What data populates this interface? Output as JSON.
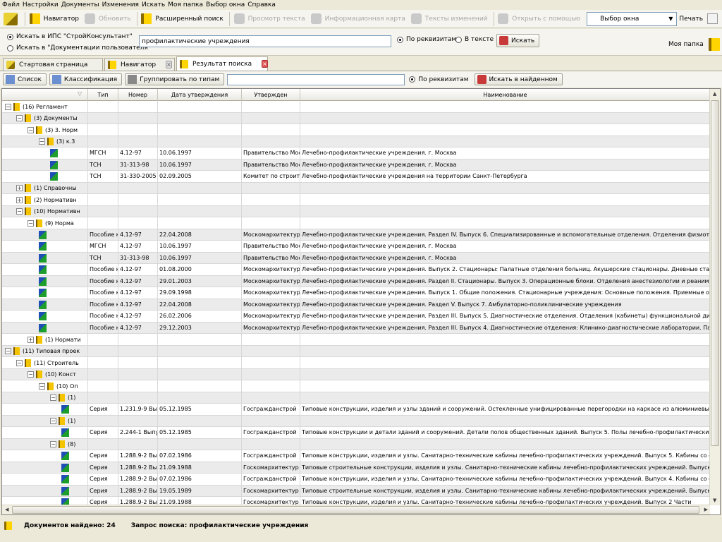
{
  "menu": [
    "Файл",
    "Настройки",
    "Документы",
    "Изменения",
    "Искать",
    "Моя папка",
    "Выбор окна",
    "Справка"
  ],
  "toolbar": {
    "navigator": "Навигатор",
    "refresh": "Обновить",
    "advanced_search": "Расширенный поиск",
    "view_text": "Просмотр текста",
    "info_card": "Информационная карта",
    "change_texts": "Тексты изменений",
    "open_with": "Открыть с помощью",
    "window_select": "Выбор окна",
    "print": "Печать"
  },
  "search": {
    "scope_ips": "Искать в ИПС \"СтройКонсультант\"",
    "scope_user": "Искать в \"Документации пользователя\"",
    "query": "профилактические учреждения",
    "mode_attrs": "По реквизитам",
    "mode_text": "В тексте",
    "search_btn": "Искать",
    "my_folder": "Моя папка"
  },
  "tabs": [
    "Стартовая страница",
    "Навигатор",
    "Результат поиска"
  ],
  "results_toolbar": {
    "list": "Список",
    "classification": "Классификация",
    "group_by_type": "Группировать по типам",
    "by_attrs": "По реквизитам",
    "search_in_found": "Искать в найденном"
  },
  "grid": {
    "headers": [
      "Тип",
      "Номер",
      "Дата утверждения",
      "Утвержден",
      "Наименование"
    ],
    "rows": [
      {
        "level": 0,
        "exp": "−",
        "kind": "folder",
        "label": "(16)  Регламент"
      },
      {
        "level": 1,
        "exp": "−",
        "kind": "folder",
        "label": "(3)  Документы"
      },
      {
        "level": 2,
        "exp": "−",
        "kind": "folder",
        "label": "(3)  3. Норм"
      },
      {
        "level": 3,
        "exp": "−",
        "kind": "folder",
        "label": "(3)  к.3"
      },
      {
        "level": 4,
        "kind": "doc",
        "type": "МГСН",
        "number": "4.12-97",
        "date": "10.06.1997",
        "approved": "Правительство Мос",
        "name": "Лечебно-профилактические учреждения. г. Москва"
      },
      {
        "level": 4,
        "kind": "doc",
        "type": "ТСН",
        "number": "31-313-98",
        "date": "10.06.1997",
        "approved": "Правительство Мос",
        "name": "Лечебно-профилактические учреждения. г. Москва"
      },
      {
        "level": 4,
        "kind": "doc",
        "type": "ТСН",
        "number": "31-330-2005",
        "date": "02.09.2005",
        "approved": "Комитет по строите",
        "name": "Лечебно-профилактические учреждения на территории Санкт-Петербурга"
      },
      {
        "level": 1,
        "exp": "+",
        "kind": "folder",
        "label": "(1)  Справочны"
      },
      {
        "level": 1,
        "exp": "+",
        "kind": "folder",
        "label": "(2)  Нормативн"
      },
      {
        "level": 1,
        "exp": "−",
        "kind": "folder",
        "label": "(10)  Нормативн"
      },
      {
        "level": 2,
        "exp": "−",
        "kind": "folder",
        "label": "(9)  Норма"
      },
      {
        "level": 3,
        "kind": "doc",
        "type": "Пособие к",
        "number": "4.12-97",
        "date": "22.04.2008",
        "approved": "Москомархитектур",
        "name": "Лечебно-профилактические учреждения. Раздел IV. Выпуск 6. Специализированные и вспомогательные отделения. Отделения физиотерапи"
      },
      {
        "level": 3,
        "kind": "doc",
        "type": "МГСН",
        "number": "4.12-97",
        "date": "10.06.1997",
        "approved": "Правительство Мос",
        "name": "Лечебно-профилактические учреждения. г. Москва"
      },
      {
        "level": 3,
        "kind": "doc",
        "type": "ТСН",
        "number": "31-313-98",
        "date": "10.06.1997",
        "approved": "Правительство Мос",
        "name": "Лечебно-профилактические учреждения. г. Москва"
      },
      {
        "level": 3,
        "kind": "doc",
        "type": "Пособие к",
        "number": "4.12-97",
        "date": "01.08.2000",
        "approved": "Москомархитектур",
        "name": "Лечебно-профилактические учреждения. Выпуск 2. Стационары: Палатные отделения больниц. Акушерские стационары. Дневные стациона"
      },
      {
        "level": 3,
        "kind": "doc",
        "type": "Пособие к",
        "number": "4.12-97",
        "date": "29.01.2003",
        "approved": "Москомархитектур",
        "name": "Лечебно-профилактические учреждения. Раздел II. Стационары. Выпуск 3. Операционные блоки. Отделения анестезиологии и реанимации. О"
      },
      {
        "level": 3,
        "kind": "doc",
        "type": "Пособие к",
        "number": "4.12-97",
        "date": "29.09.1998",
        "approved": "Москомархитектур",
        "name": "Лечебно-профилактические учреждения. Выпуск 1. Общие положения. Стационарные учреждения: Основные положения. Приемные отделе"
      },
      {
        "level": 3,
        "kind": "doc",
        "type": "Пособие к",
        "number": "4.12-97",
        "date": "22.04.2008",
        "approved": "Москомархитектур",
        "name": "Лечебно-профилактические учреждения. Раздел V. Выпуск 7. Амбулаторно-поликлинические учреждения"
      },
      {
        "level": 3,
        "kind": "doc",
        "type": "Пособие к",
        "number": "4.12-97",
        "date": "26.02.2006",
        "approved": "Москомархитектур",
        "name": "Лечебно-профилактические учреждения. Раздел III. Выпуск 5. Диагностические отделения. Отделения (кабинеты) функциональной диагно"
      },
      {
        "level": 3,
        "kind": "doc",
        "type": "Пособие к",
        "number": "4.12-97",
        "date": "29.12.2003",
        "approved": "Москомархитектур",
        "name": "Лечебно-профилактические учреждения. Раздел III. Выпуск 4. Диагностические отделения: Клинико-диагностические лаборатории. Патал"
      },
      {
        "level": 2,
        "exp": "+",
        "kind": "folder",
        "label": "(1)  Нормати"
      },
      {
        "level": 0,
        "exp": "−",
        "kind": "folder",
        "label": "(11)  Типовая проек"
      },
      {
        "level": 1,
        "exp": "−",
        "kind": "folder",
        "label": "(11)  Строитель"
      },
      {
        "level": 2,
        "exp": "−",
        "kind": "folder",
        "label": "(10)  Конст"
      },
      {
        "level": 3,
        "exp": "−",
        "kind": "folder",
        "label": "(10)  Оп"
      },
      {
        "level": 4,
        "exp": "−",
        "kind": "folder",
        "label": "(1)"
      },
      {
        "level": 5,
        "kind": "doc",
        "type": "Серия",
        "number": "1.231.9-9 Вып",
        "date": "05.12.1985",
        "approved": "Госгражданстрой",
        "name": "Типовые конструкции, изделия и узлы зданий и сооружений. Остекленные унифицированные перегородки на каркасе из алюминиевых спла"
      },
      {
        "level": 4,
        "exp": "−",
        "kind": "folder",
        "label": "(1)"
      },
      {
        "level": 5,
        "kind": "doc",
        "type": "Серия",
        "number": "2.244-1 Выпу",
        "date": "05.12.1985",
        "approved": "Госгражданстрой",
        "name": "Типовые конструкции и детали зданий и сооружений. Детали полов общественных зданий. Выпуск 5. Полы лечебно-профилактических учре"
      },
      {
        "level": 4,
        "exp": "−",
        "kind": "folder",
        "label": "(8)"
      },
      {
        "level": 5,
        "kind": "doc",
        "type": "Серия",
        "number": "1.288.9-2 Вы",
        "date": "07.02.1986",
        "approved": "Госгражданстрой",
        "name": "Типовые конструкции, изделия и узлы. Санитарно-технические кабины лечебно-профилактических учреждений. Выпуск 5. Кабины со стена"
      },
      {
        "level": 5,
        "kind": "doc",
        "type": "Серия",
        "number": "1.288.9-2 Вы",
        "date": "21.09.1988",
        "approved": "Госкомархитектур",
        "name": "Типовые строительные конструкции, изделия и узлы. Санитарно-технические кабины лечебно-профилактических учреждений. Выпуск 2 Ча"
      },
      {
        "level": 5,
        "kind": "doc",
        "type": "Серия",
        "number": "1.288.9-2 Вы",
        "date": "07.02.1986",
        "approved": "Госгражданстрой",
        "name": "Типовые конструкции, изделия и узлы. Санитарно-технические кабины лечебно-профилактических учреждений. Выпуск 4. Кабины со стена"
      },
      {
        "level": 5,
        "kind": "doc",
        "type": "Серия",
        "number": "1.288.9-2 Вы",
        "date": "19.05.1989",
        "approved": "Госкомархитектур",
        "name": "Типовые строительные конструкции, изделия и узлы. Санитарно-технические кабины лечебно-профилактических учреждений. Выпуск 3. Ка"
      },
      {
        "level": 5,
        "kind": "doc",
        "type": "Серия",
        "number": "1.288.9-2 Вы",
        "date": "21.09.1988",
        "approved": "Госкомархитектур",
        "name": "Типовые конструкции, изделия и узлы. Санитарно-технические кабины лечебно-профилактических учреждений. Выпуск 2 Части"
      }
    ]
  },
  "status": {
    "found": "Документов найдено: 24",
    "query": "Запрос поиска: профилактические учреждения"
  }
}
